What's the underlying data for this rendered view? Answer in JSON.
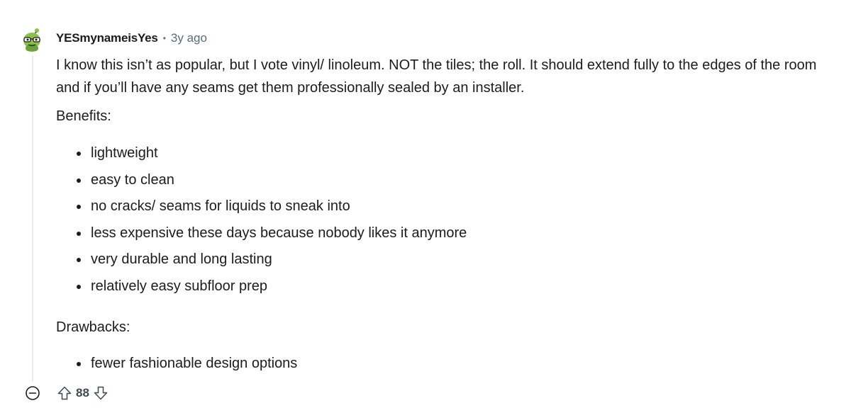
{
  "comment": {
    "author": "YESmynameisYes",
    "separator": "•",
    "timestamp": "3y ago",
    "paragraph": "I know this isn’t as popular, but I vote vinyl/ linoleum. NOT the tiles; the roll. It should extend fully to the edges of the room and if you’ll have any seams get them professionally sealed by an installer.",
    "benefits_heading": "Benefits:",
    "benefits": [
      "lightweight",
      "easy to clean",
      "no cracks/ seams for liquids to sneak into",
      "less expensive these days because nobody likes it anymore",
      "very durable and long lasting",
      "relatively easy subfloor prep"
    ],
    "drawbacks_heading": "Drawbacks:",
    "drawbacks": [
      "fewer fashionable design options"
    ]
  },
  "actions": {
    "score": "88",
    "collapse_icon": "collapse-minus-icon",
    "upvote_icon": "upvote-arrow-icon",
    "downvote_icon": "downvote-arrow-icon"
  },
  "colors": {
    "text": "#1c1c1c",
    "muted": "#576f76",
    "thread_line": "#e5ebee",
    "avatar_green": "#8bc34a"
  }
}
